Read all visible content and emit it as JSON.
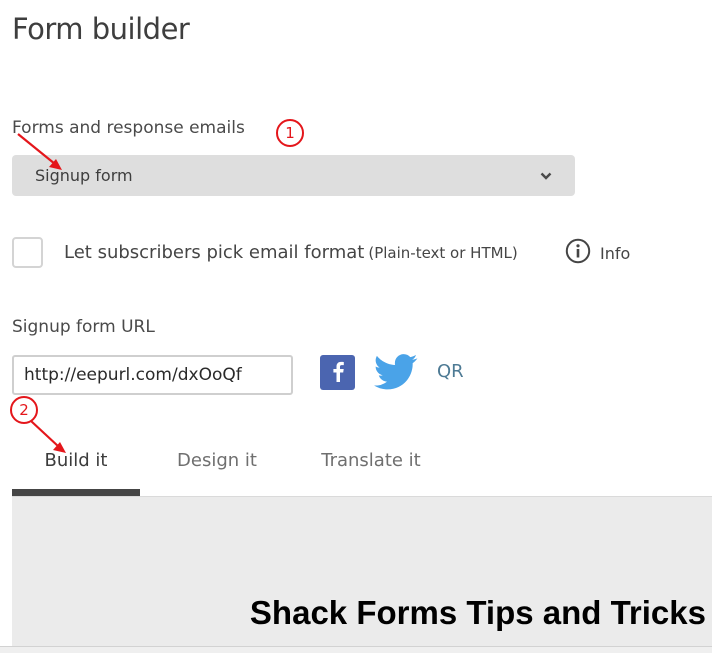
{
  "header": {
    "title": "Form builder"
  },
  "forms": {
    "label": "Forms and response emails",
    "selected": "Signup form",
    "dropdown_icon": "chevron-down-icon"
  },
  "email_format": {
    "checked": false,
    "label": "Let subscribers pick email format",
    "hint": "(Plain-text or HTML)",
    "info_icon": "info-circle-icon",
    "info_label": "Info"
  },
  "signup_url": {
    "label": "Signup form URL",
    "value": "http://eepurl.com/dxOoQf",
    "share": {
      "facebook_icon": "facebook-icon",
      "twitter_icon": "twitter-icon",
      "qr_label": "QR"
    }
  },
  "tabs": [
    {
      "label": "Build it",
      "active": true
    },
    {
      "label": "Design it",
      "active": false
    },
    {
      "label": "Translate it",
      "active": false
    }
  ],
  "preview": {
    "title": "Shack Forms Tips and Tricks"
  },
  "annotations": [
    {
      "number": "1",
      "target": "Signup form dropdown"
    },
    {
      "number": "2",
      "target": "Build it tab"
    }
  ],
  "colors": {
    "annotation_red": "#e4161b",
    "facebook_blue": "#4b65b0",
    "twitter_blue": "#4aa3e8",
    "qr_link": "#4d7a94",
    "active_tab_bar": "#454545"
  }
}
